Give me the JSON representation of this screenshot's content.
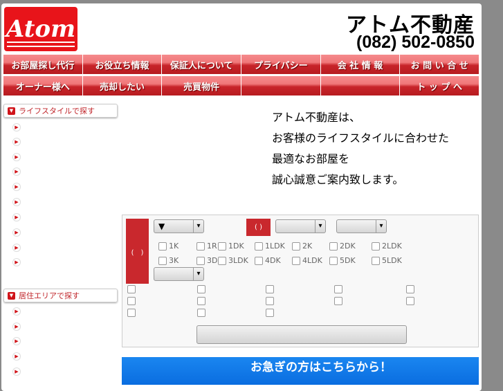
{
  "header": {
    "logo_text": "Atom",
    "company": "アトム不動産",
    "phone": "(082) 502-0850"
  },
  "nav_row1": [
    "お部屋探し代行",
    "お役立ち情報",
    "保証人について",
    "プライバシー",
    "会 社 情 報",
    "お 問 い 合 せ"
  ],
  "nav_row2": [
    "オーナー様へ",
    "売却したい",
    "売買物件",
    "",
    "",
    "ト ッ プ へ"
  ],
  "sidebar": {
    "lifestyle_title": "ライフスタイルで探す",
    "area_title": "居住エリアで探す"
  },
  "intro": [
    "アトム不動産は、",
    "お客様のライフスタイルに合わせた",
    "最適なお部屋を",
    "誠心誠意ご案内致します。"
  ],
  "search": {
    "side_label": "(　)",
    "mid_label": "( )",
    "select1": "▼",
    "layouts_row1": [
      "1K",
      "1R",
      "1DK",
      "1LDK",
      "2K",
      "2DK",
      "2LDK"
    ],
    "layouts_row2": [
      "3K",
      "3DK",
      "3LDK",
      "4DK",
      "4LDK",
      "5DK",
      "5LDK"
    ]
  },
  "banner": {
    "text": "お急ぎの方はこちらから！"
  }
}
